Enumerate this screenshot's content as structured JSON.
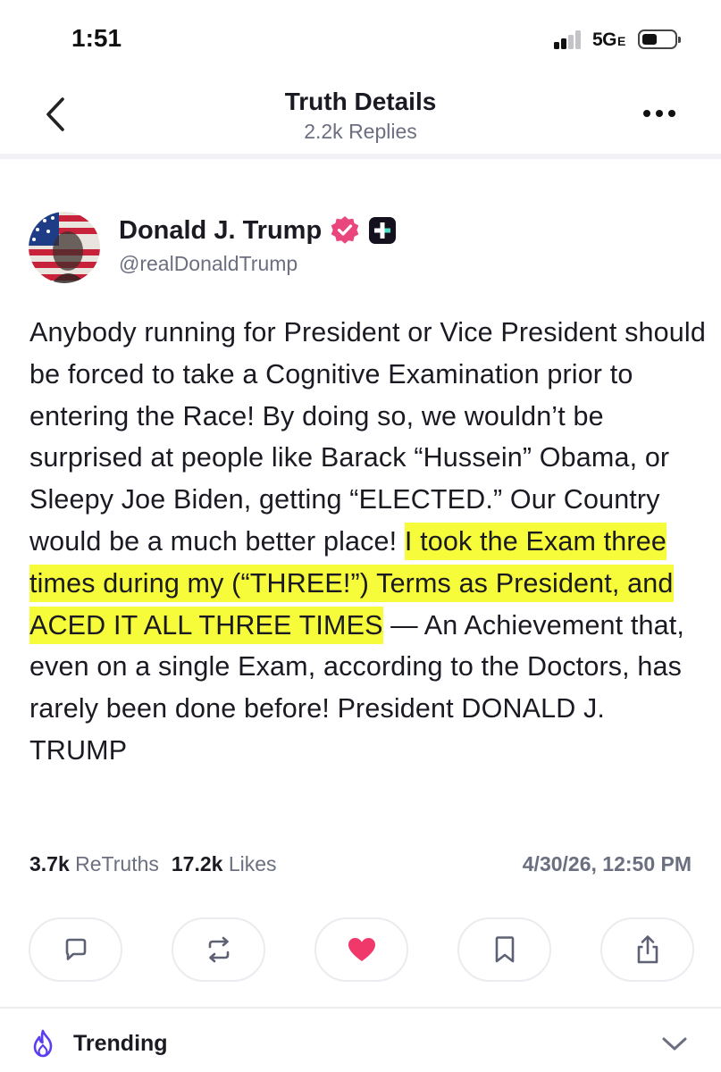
{
  "status_bar": {
    "time": "1:51",
    "network": "5G",
    "network_suffix": "E"
  },
  "header": {
    "title": "Truth Details",
    "subtitle": "2.2k Replies",
    "back_icon": "chevron-left-icon",
    "more_icon": "more-horizontal-icon"
  },
  "post": {
    "author_name": "Donald J. Trump",
    "handle": "@realDonaldTrump",
    "verified_icon": "verified-badge-icon",
    "verified_color": "#e8467c",
    "plus_icon": "plus-badge-icon",
    "text_before": "Anybody running for President or Vice President should be forced to take a Cognitive Examination prior to entering the Race! By doing so, we wouldn’t be surprised at people like Barack “Hussein” Obama, or Sleepy Joe Biden, getting “ELECTED.” Our Country would be a much better place! ",
    "text_highlighted": "I took the Exam three times during my (“THREE!”) Terms as President, and ACED IT ALL THREE TIMES",
    "text_after": " — An Achievement that, even on a single Exam, according to the Doctors, has rarely been done before! President DONALD J. TRUMP",
    "highlight_color": "#f6fb3a",
    "retruths_count": "3.7k",
    "retruths_label": "ReTruths",
    "likes_count": "17.2k",
    "likes_label": "Likes",
    "timestamp": "4/30/26, 12:50 PM"
  },
  "actions": [
    {
      "icon": "reply-icon"
    },
    {
      "icon": "retruth-icon"
    },
    {
      "icon": "heart-icon",
      "color": "#f0386b"
    },
    {
      "icon": "bookmark-icon"
    },
    {
      "icon": "share-icon"
    }
  ],
  "trending": {
    "label": "Trending",
    "icon": "flame-icon",
    "icon_color": "#5b3ef0",
    "expand_icon": "chevron-down-icon"
  }
}
